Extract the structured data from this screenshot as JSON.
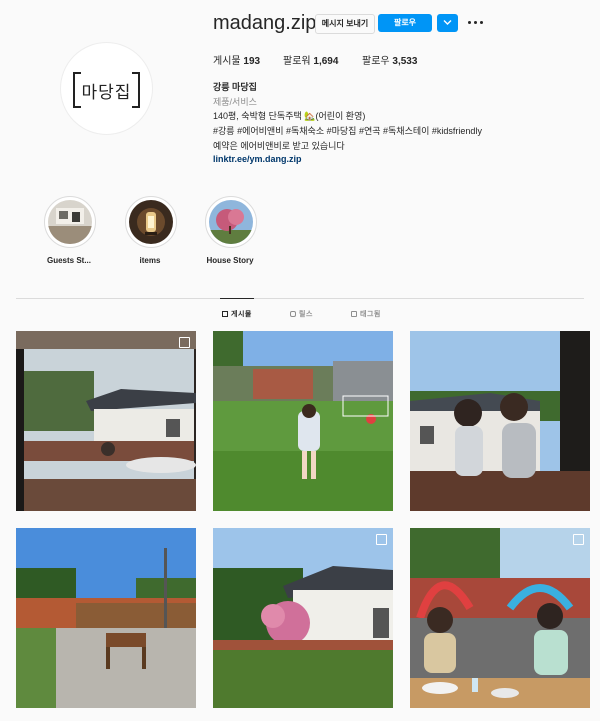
{
  "profile": {
    "username": "madang.zip",
    "avatar_text": "마당집",
    "message_button": "메시지 보내기",
    "follow_button": "팔로우",
    "stats": {
      "posts_label": "게시물",
      "posts_value": "193",
      "followers_label": "팔로워",
      "followers_value": "1,694",
      "following_label": "팔로우",
      "following_value": "3,533"
    },
    "bio": {
      "name": "강릉 마당집",
      "category": "제품/서비스",
      "line1": "140평, 숙박형 단독주택 🏡(어린이 환영)",
      "line2": "#강릉 #에어비앤비 #독채숙소 #마당집 #연곡 #독채스테이 #kidsfriendly",
      "line3": "예약은 에어비앤비로 받고 있습니다",
      "link": "linktr.ee/ym.dang.zip"
    }
  },
  "highlights": [
    {
      "label": "Guests St..."
    },
    {
      "label": "items"
    },
    {
      "label": "House Story"
    }
  ],
  "tabs": [
    {
      "label": "게시물",
      "active": true
    },
    {
      "label": "릴스",
      "active": false
    },
    {
      "label": "태그됨",
      "active": false
    }
  ],
  "colors": {
    "accent": "#0095f6",
    "link": "#00376b",
    "background": "#fafafa"
  }
}
